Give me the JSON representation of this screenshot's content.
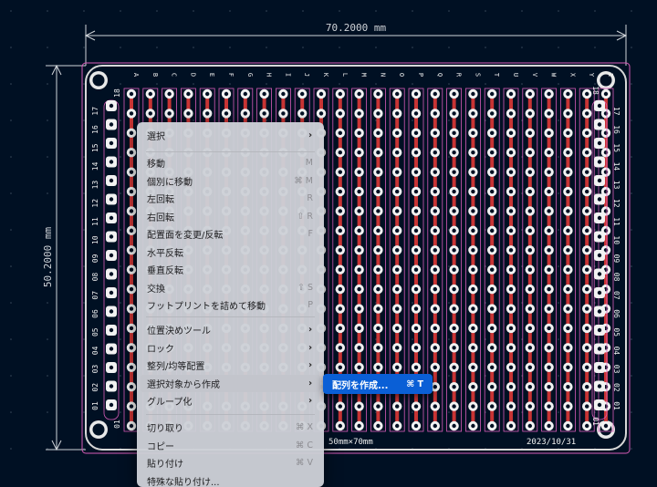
{
  "dimensions": {
    "width_label": "70.2000 mm",
    "height_label": "50.2000 mm"
  },
  "board": {
    "col_labels": [
      "A",
      "B",
      "C",
      "D",
      "E",
      "F",
      "G",
      "H",
      "I",
      "J",
      "K",
      "L",
      "M",
      "N",
      "O",
      "P",
      "Q",
      "R",
      "S",
      "T",
      "U",
      "V",
      "W",
      "X",
      "Y",
      "Z"
    ],
    "row_labels": [
      "01",
      "02",
      "03",
      "04",
      "05",
      "06",
      "07",
      "08",
      "09",
      "10",
      "11",
      "12",
      "13",
      "14",
      "15",
      "16",
      "17"
    ],
    "corner_tl": "18",
    "corner_tr": "18",
    "corner_bl": "01",
    "corner_br": "01",
    "size_label": "50mm×70mm",
    "date_label": "2023/10/31"
  },
  "context_menu": {
    "items": [
      {
        "label": "選択",
        "shortcut": "",
        "submenu": true
      },
      {
        "label": "移動",
        "shortcut": "M",
        "submenu": false
      },
      {
        "label": "個別に移動",
        "shortcut": "⌘ M",
        "submenu": false
      },
      {
        "label": "左回転",
        "shortcut": "R",
        "submenu": false
      },
      {
        "label": "右回転",
        "shortcut": "⇧ R",
        "submenu": false
      },
      {
        "label": "配置面を変更/反転",
        "shortcut": "F",
        "submenu": false
      },
      {
        "label": "水平反転",
        "shortcut": "",
        "submenu": false
      },
      {
        "label": "垂直反転",
        "shortcut": "",
        "submenu": false
      },
      {
        "label": "交換",
        "shortcut": "⇧ S",
        "submenu": false
      },
      {
        "label": "フットプリントを詰めて移動",
        "shortcut": "P",
        "submenu": false
      },
      {
        "label": "位置決めツール",
        "shortcut": "",
        "submenu": true
      },
      {
        "label": "ロック",
        "shortcut": "",
        "submenu": true
      },
      {
        "label": "整列/均等配置",
        "shortcut": "",
        "submenu": true
      },
      {
        "label": "選択対象から作成",
        "shortcut": "",
        "submenu": true
      },
      {
        "label": "グループ化",
        "shortcut": "",
        "submenu": true
      },
      {
        "label": "切り取り",
        "shortcut": "⌘ X",
        "submenu": false
      },
      {
        "label": "コピー",
        "shortcut": "⌘ C",
        "submenu": false
      },
      {
        "label": "貼り付け",
        "shortcut": "⌘ V",
        "submenu": false
      },
      {
        "label": "特殊な貼り付け...",
        "shortcut": "",
        "submenu": false
      }
    ]
  },
  "submenu": {
    "label": "配列を作成...",
    "shortcut": "⌘ T"
  },
  "colors": {
    "background": "#001023",
    "board_outline": "#d8d8d8",
    "dimension": "#cfd3d8",
    "courtyard": "#d95bb8",
    "copper": "#c83434",
    "pad": "#f2f2f2",
    "silk": "#f2f2f2",
    "submenu_highlight": "#0a5fd6",
    "arrow": "#ff2d6e"
  }
}
